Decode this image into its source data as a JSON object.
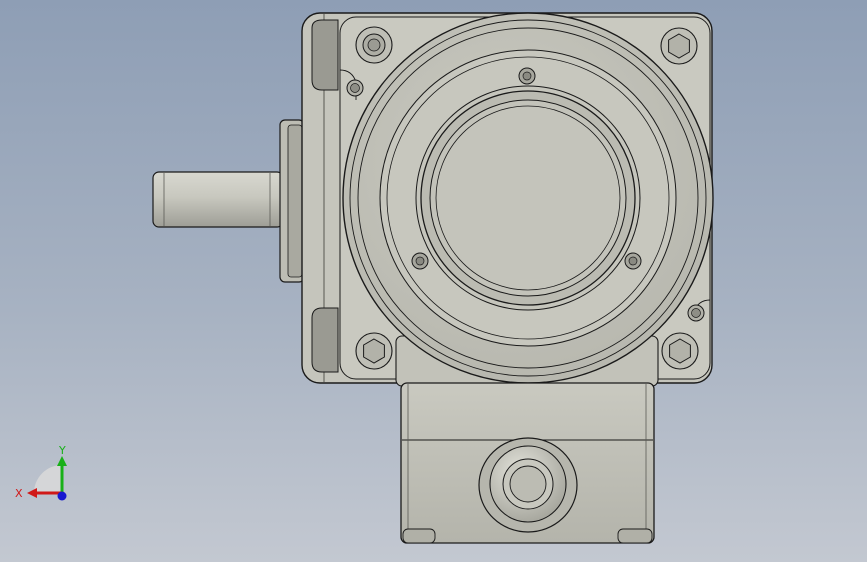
{
  "axis_triad": {
    "x_label": "X",
    "y_label": "Y",
    "x_color": "#d01818",
    "y_color": "#18b018",
    "z_color": "#1818d0"
  },
  "colors": {
    "body_fill": "#c5c5bc",
    "body_shade": "#a9a9a0",
    "edge": "#1a1a1a"
  }
}
